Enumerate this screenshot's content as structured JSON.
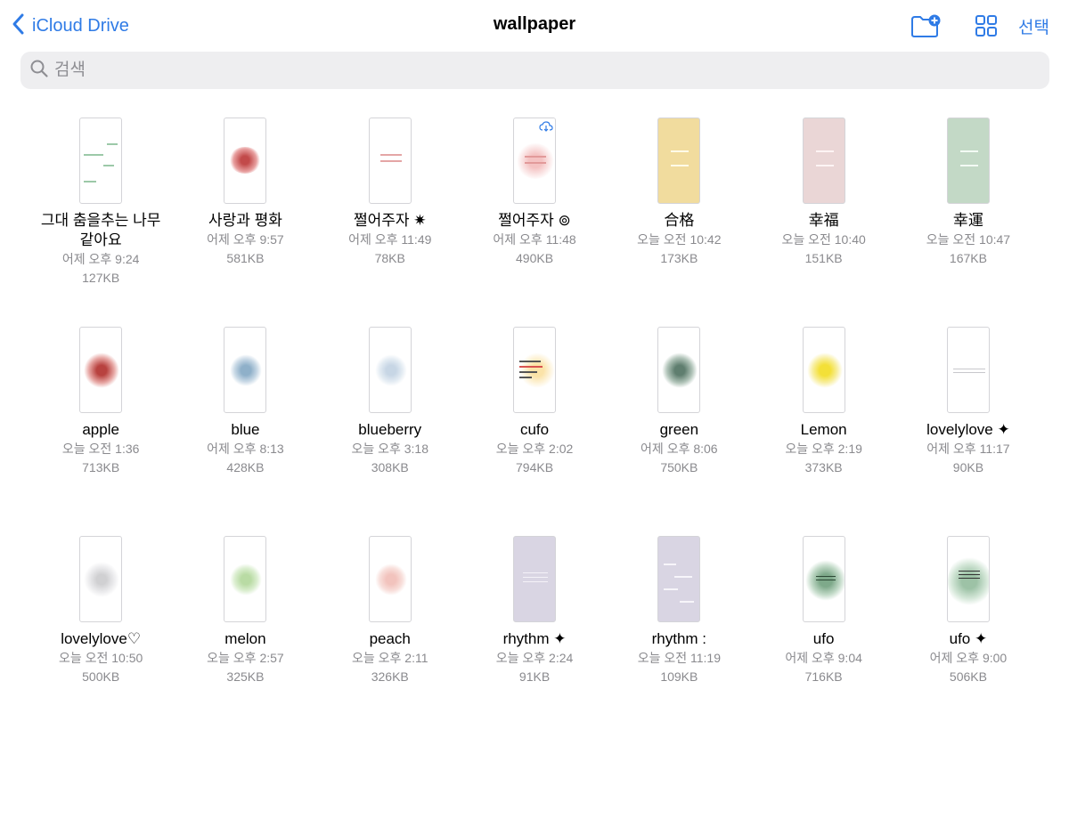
{
  "nav": {
    "back_label": "iCloud Drive",
    "title": "wallpaper",
    "select_label": "선택"
  },
  "search": {
    "placeholder": "검색"
  },
  "colors": {
    "accent": "#2f7be6"
  },
  "icons": {
    "back": "chevron-left-icon",
    "new_folder": "folder-plus-icon",
    "view": "grid-view-icon",
    "search": "magnifier-icon",
    "download": "cloud-download-icon"
  },
  "files": [
    {
      "name": "그대 춤을추는 나무 같아요",
      "date": "어제 오후 9:24",
      "size": "127KB"
    },
    {
      "name": "사랑과 평화",
      "date": "어제 오후 9:57",
      "size": "581KB"
    },
    {
      "name": "쩔어주자 ✷",
      "date": "어제 오후 11:49",
      "size": "78KB"
    },
    {
      "name": "쩔어주자 ⊚",
      "date": "어제 오후 11:48",
      "size": "490KB",
      "cloud": true
    },
    {
      "name": "合格",
      "date": "오늘 오전 10:42",
      "size": "173KB"
    },
    {
      "name": "幸福",
      "date": "오늘 오전 10:40",
      "size": "151KB"
    },
    {
      "name": "幸運",
      "date": "오늘 오전 10:47",
      "size": "167KB"
    },
    {
      "name": "apple",
      "date": "오늘 오전 1:36",
      "size": "713KB"
    },
    {
      "name": "blue",
      "date": "어제 오후 8:13",
      "size": "428KB"
    },
    {
      "name": "blueberry",
      "date": "오늘 오후 3:18",
      "size": "308KB"
    },
    {
      "name": "cufo",
      "date": "오늘 오후 2:02",
      "size": "794KB"
    },
    {
      "name": "green",
      "date": "어제 오후 8:06",
      "size": "750KB"
    },
    {
      "name": "Lemon",
      "date": "오늘 오후 2:19",
      "size": "373KB"
    },
    {
      "name": "lovelylove ✦",
      "date": "어제 오후 11:17",
      "size": "90KB"
    },
    {
      "name": "lovelylove♡",
      "date": "오늘 오전 10:50",
      "size": "500KB"
    },
    {
      "name": "melon",
      "date": "오늘 오후 2:57",
      "size": "325KB"
    },
    {
      "name": "peach",
      "date": "오늘 오후 2:11",
      "size": "326KB"
    },
    {
      "name": "rhythm ✦",
      "date": "오늘 오후 2:24",
      "size": "91KB"
    },
    {
      "name": "rhythm :",
      "date": "오늘 오전 11:19",
      "size": "109KB"
    },
    {
      "name": "ufo",
      "date": "어제 오후 9:04",
      "size": "716KB"
    },
    {
      "name": "ufo ✦",
      "date": "어제 오후 9:00",
      "size": "506KB"
    }
  ]
}
